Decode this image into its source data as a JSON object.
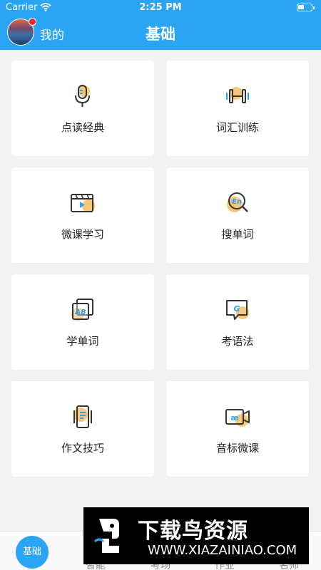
{
  "status": {
    "carrier": "Carrier",
    "time": "2:25 PM"
  },
  "header": {
    "mine_label": "我的",
    "title": "基础"
  },
  "cards": [
    {
      "label": "点读经典",
      "icon": "microphone-icon"
    },
    {
      "label": "词汇训练",
      "icon": "dumbbell-icon"
    },
    {
      "label": "微课学习",
      "icon": "video-icon"
    },
    {
      "label": "搜单词",
      "icon": "search-word-icon",
      "icon_text": "En"
    },
    {
      "label": "学单词",
      "icon": "word-cards-icon",
      "icon_text": "AB"
    },
    {
      "label": "考语法",
      "icon": "grammar-bubble-icon",
      "icon_text": "G"
    },
    {
      "label": "作文技巧",
      "icon": "writing-phone-icon"
    },
    {
      "label": "音标微课",
      "icon": "phonetic-camera-icon",
      "icon_text": "æ"
    }
  ],
  "tabbar": {
    "home": "基础",
    "tabs": [
      "智能",
      "考场",
      "作业",
      "名师"
    ]
  },
  "watermark": {
    "title": "下载鸟资源",
    "url": "WWW.XIAZAINIAO.COM"
  },
  "colors": {
    "header": "#2aa4f4",
    "icon_accent": "#f7c77a",
    "icon_stroke": "#333333",
    "icon_blue": "#2aa4f4"
  }
}
